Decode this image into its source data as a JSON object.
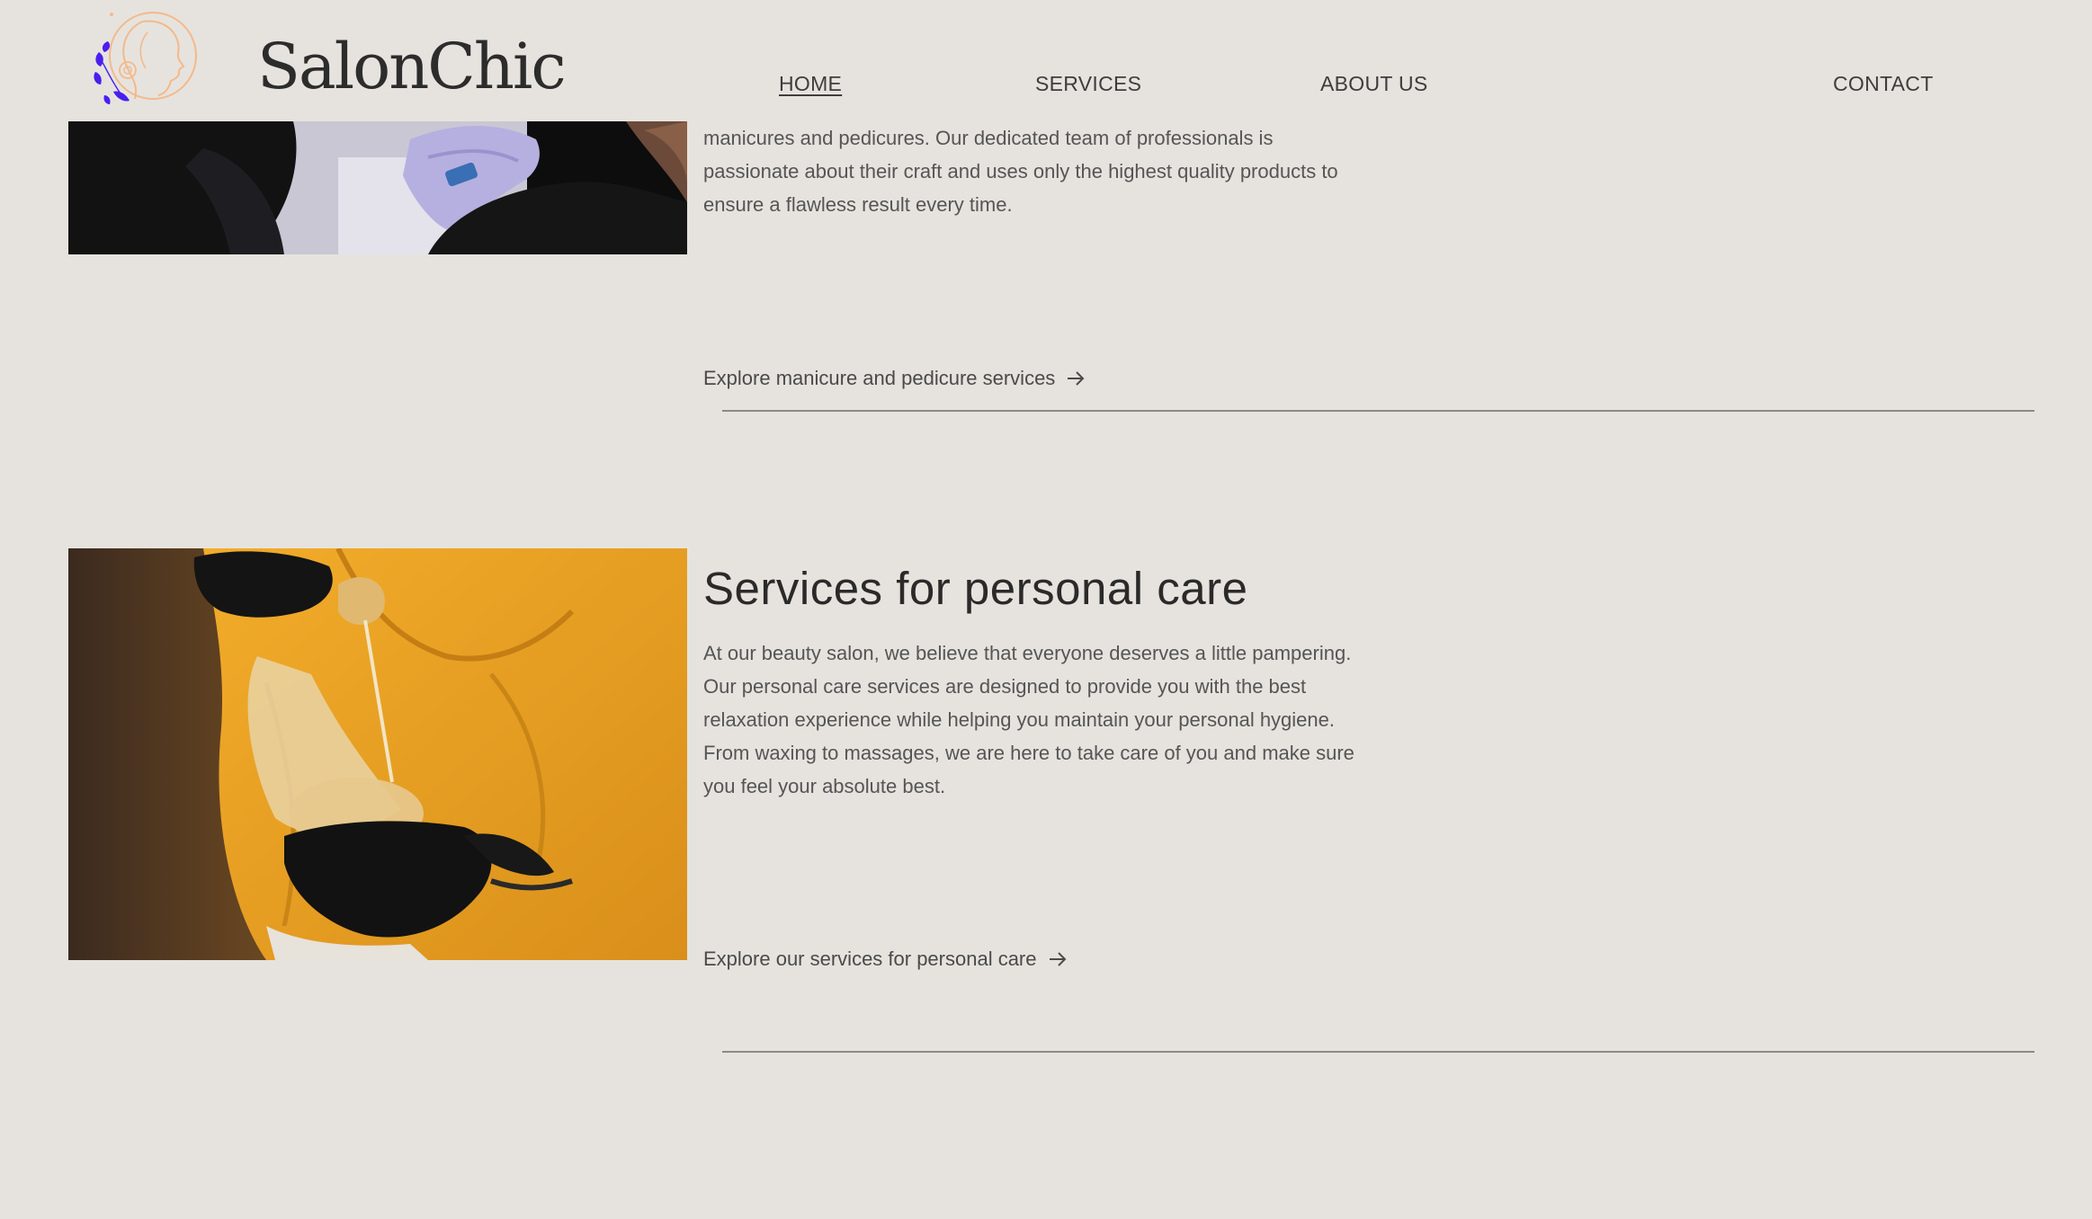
{
  "header": {
    "brand": "SalonChic",
    "nav": {
      "home": "HOME",
      "services": "SERVICES",
      "about": "ABOUT US",
      "contact": "CONTACT"
    }
  },
  "sections": {
    "manicure": {
      "description": "manicures and pedicures. Our dedicated team of professionals is passionate about their craft and uses only the highest quality products to ensure a flawless result every time.",
      "link": "Explore manicure and pedicure services"
    },
    "personal_care": {
      "title": "Services for personal care",
      "description": "At our beauty salon, we believe that everyone deserves a little pampering. Our personal care services are designed to provide you with the best relaxation experience while helping you maintain your personal hygiene. From waxing to massages, we are here to take care of you and make sure you feel your absolute best.",
      "link": "Explore our services for personal care"
    }
  },
  "icons": {
    "logo": "woman-profile-logo-icon",
    "arrow": "arrow-right-icon"
  },
  "colors": {
    "background": "#e6e3de",
    "logo_outline": "#f4b98a",
    "logo_leaves": "#4a1ef0",
    "divider": "#8a8a8a"
  }
}
